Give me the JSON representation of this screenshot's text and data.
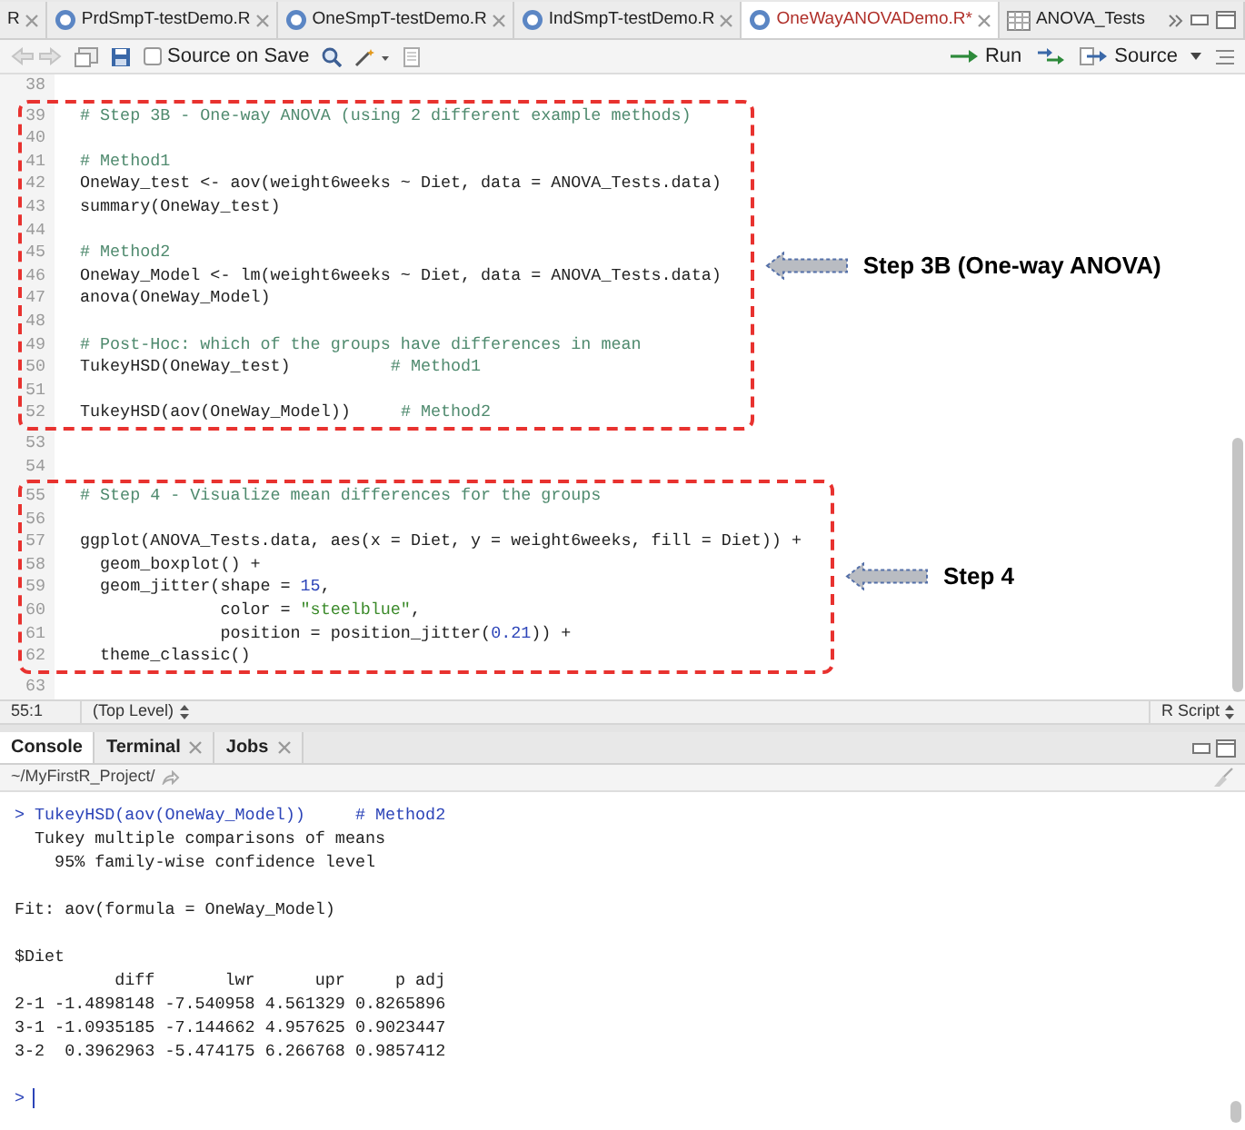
{
  "editor_tabs": [
    {
      "label": "R",
      "kind": "cut",
      "selected": false
    },
    {
      "label": "PrdSmpT-testDemo.R",
      "kind": "script",
      "selected": false
    },
    {
      "label": "OneSmpT-testDemo.R",
      "kind": "script",
      "selected": false
    },
    {
      "label": "IndSmpT-testDemo.R",
      "kind": "script",
      "selected": false
    },
    {
      "label": "OneWayANOVADemo.R*",
      "kind": "script",
      "selected": true
    },
    {
      "label": "ANOVA_Tests",
      "kind": "data",
      "selected": false
    }
  ],
  "toolbar": {
    "source_on_save": {
      "label": "Source on Save",
      "checked": false
    },
    "run": "Run",
    "source": "Source"
  },
  "editor": {
    "sections": [
      {
        "lines": [
          {
            "number": "38"
          }
        ]
      },
      {
        "callout": "Step 3B (One-way ANOVA)",
        "lines": [
          {
            "number": "39",
            "segments": [
              {
                "kind": "comment",
                "text": "# Step 3B - One-way ANOVA (using 2 different example methods)"
              }
            ]
          },
          {
            "number": "40"
          },
          {
            "number": "41",
            "segments": [
              {
                "kind": "comment",
                "text": "# Method1"
              }
            ]
          },
          {
            "number": "42",
            "segments": [
              {
                "kind": "code",
                "text": "OneWay_test <- aov(weight6weeks ~ Diet, data = ANOVA_Tests.data)"
              }
            ]
          },
          {
            "number": "43",
            "segments": [
              {
                "kind": "code",
                "text": "summary(OneWay_test)"
              }
            ]
          },
          {
            "number": "44"
          },
          {
            "number": "45",
            "segments": [
              {
                "kind": "comment",
                "text": "# Method2"
              }
            ]
          },
          {
            "number": "46",
            "segments": [
              {
                "kind": "code",
                "text": "OneWay_Model <- lm(weight6weeks ~ Diet, data = ANOVA_Tests.data)"
              }
            ]
          },
          {
            "number": "47",
            "segments": [
              {
                "kind": "code",
                "text": "anova(OneWay_Model)"
              }
            ]
          },
          {
            "number": "48"
          },
          {
            "number": "49",
            "segments": [
              {
                "kind": "comment",
                "text": "# Post-Hoc: which of the groups have differences in mean"
              }
            ]
          },
          {
            "number": "50",
            "segments": [
              {
                "kind": "code",
                "text": "TukeyHSD(OneWay_test)          "
              },
              {
                "kind": "comment",
                "text": "# Method1"
              }
            ]
          },
          {
            "number": "51"
          },
          {
            "number": "52",
            "segments": [
              {
                "kind": "code",
                "text": "TukeyHSD(aov(OneWay_Model))     "
              },
              {
                "kind": "comment",
                "text": "# Method2"
              }
            ]
          }
        ]
      },
      {
        "lines": [
          {
            "number": "53"
          },
          {
            "number": "54"
          }
        ]
      },
      {
        "callout": "Step 4",
        "lines": [
          {
            "number": "55",
            "segments": [
              {
                "kind": "comment",
                "text": "# Step 4 - Visualize mean differences for the groups"
              }
            ]
          },
          {
            "number": "56"
          },
          {
            "number": "57",
            "segments": [
              {
                "kind": "code",
                "text": "ggplot(ANOVA_Tests.data, aes(x = Diet, y = weight6weeks, fill = Diet)) +"
              }
            ]
          },
          {
            "number": "58",
            "segments": [
              {
                "kind": "code",
                "text": "  geom_boxplot() +"
              }
            ]
          },
          {
            "number": "59",
            "segments": [
              {
                "kind": "code",
                "text": "  geom_jitter(shape = "
              },
              {
                "kind": "number",
                "text": "15"
              },
              {
                "kind": "code",
                "text": ","
              }
            ]
          },
          {
            "number": "60",
            "segments": [
              {
                "kind": "code",
                "text": "              color = "
              },
              {
                "kind": "string",
                "text": "\"steelblue\""
              },
              {
                "kind": "code",
                "text": ","
              }
            ]
          },
          {
            "number": "61",
            "segments": [
              {
                "kind": "code",
                "text": "              position = position_jitter("
              },
              {
                "kind": "number",
                "text": "0.21"
              },
              {
                "kind": "code",
                "text": ")) +"
              }
            ]
          },
          {
            "number": "62",
            "segments": [
              {
                "kind": "code",
                "text": "  theme_classic()"
              }
            ]
          }
        ]
      },
      {
        "lines": [
          {
            "number": "63"
          }
        ]
      }
    ]
  },
  "status_bar": {
    "position": "55:1",
    "scope": "(Top Level)",
    "file_type": "R Script"
  },
  "console_tabs": [
    {
      "label": "Console",
      "selected": true,
      "closable": false
    },
    {
      "label": "Terminal",
      "selected": false,
      "closable": true
    },
    {
      "label": "Jobs",
      "selected": false,
      "closable": true
    }
  ],
  "console": {
    "path": "~/MyFirstR_Project/",
    "lines": [
      {
        "kind": "input",
        "text": "> TukeyHSD(aov(OneWay_Model))     # Method2"
      },
      {
        "kind": "output",
        "text": "  Tukey multiple comparisons of means"
      },
      {
        "kind": "output",
        "text": "    95% family-wise confidence level"
      },
      {
        "kind": "blank"
      },
      {
        "kind": "output",
        "text": "Fit: aov(formula = OneWay_Model)"
      },
      {
        "kind": "blank"
      },
      {
        "kind": "output",
        "text": "$Diet"
      },
      {
        "kind": "output",
        "text": "          diff       lwr      upr     p adj"
      },
      {
        "kind": "output",
        "text": "2-1 -1.4898148 -7.540958 4.561329 0.8265896"
      },
      {
        "kind": "output",
        "text": "3-1 -1.0935185 -7.144662 4.957625 0.9023447"
      },
      {
        "kind": "output",
        "text": "3-2  0.3962963 -5.474175 6.266768 0.9857412"
      },
      {
        "kind": "blank"
      },
      {
        "kind": "prompt",
        "text": ">"
      }
    ]
  }
}
